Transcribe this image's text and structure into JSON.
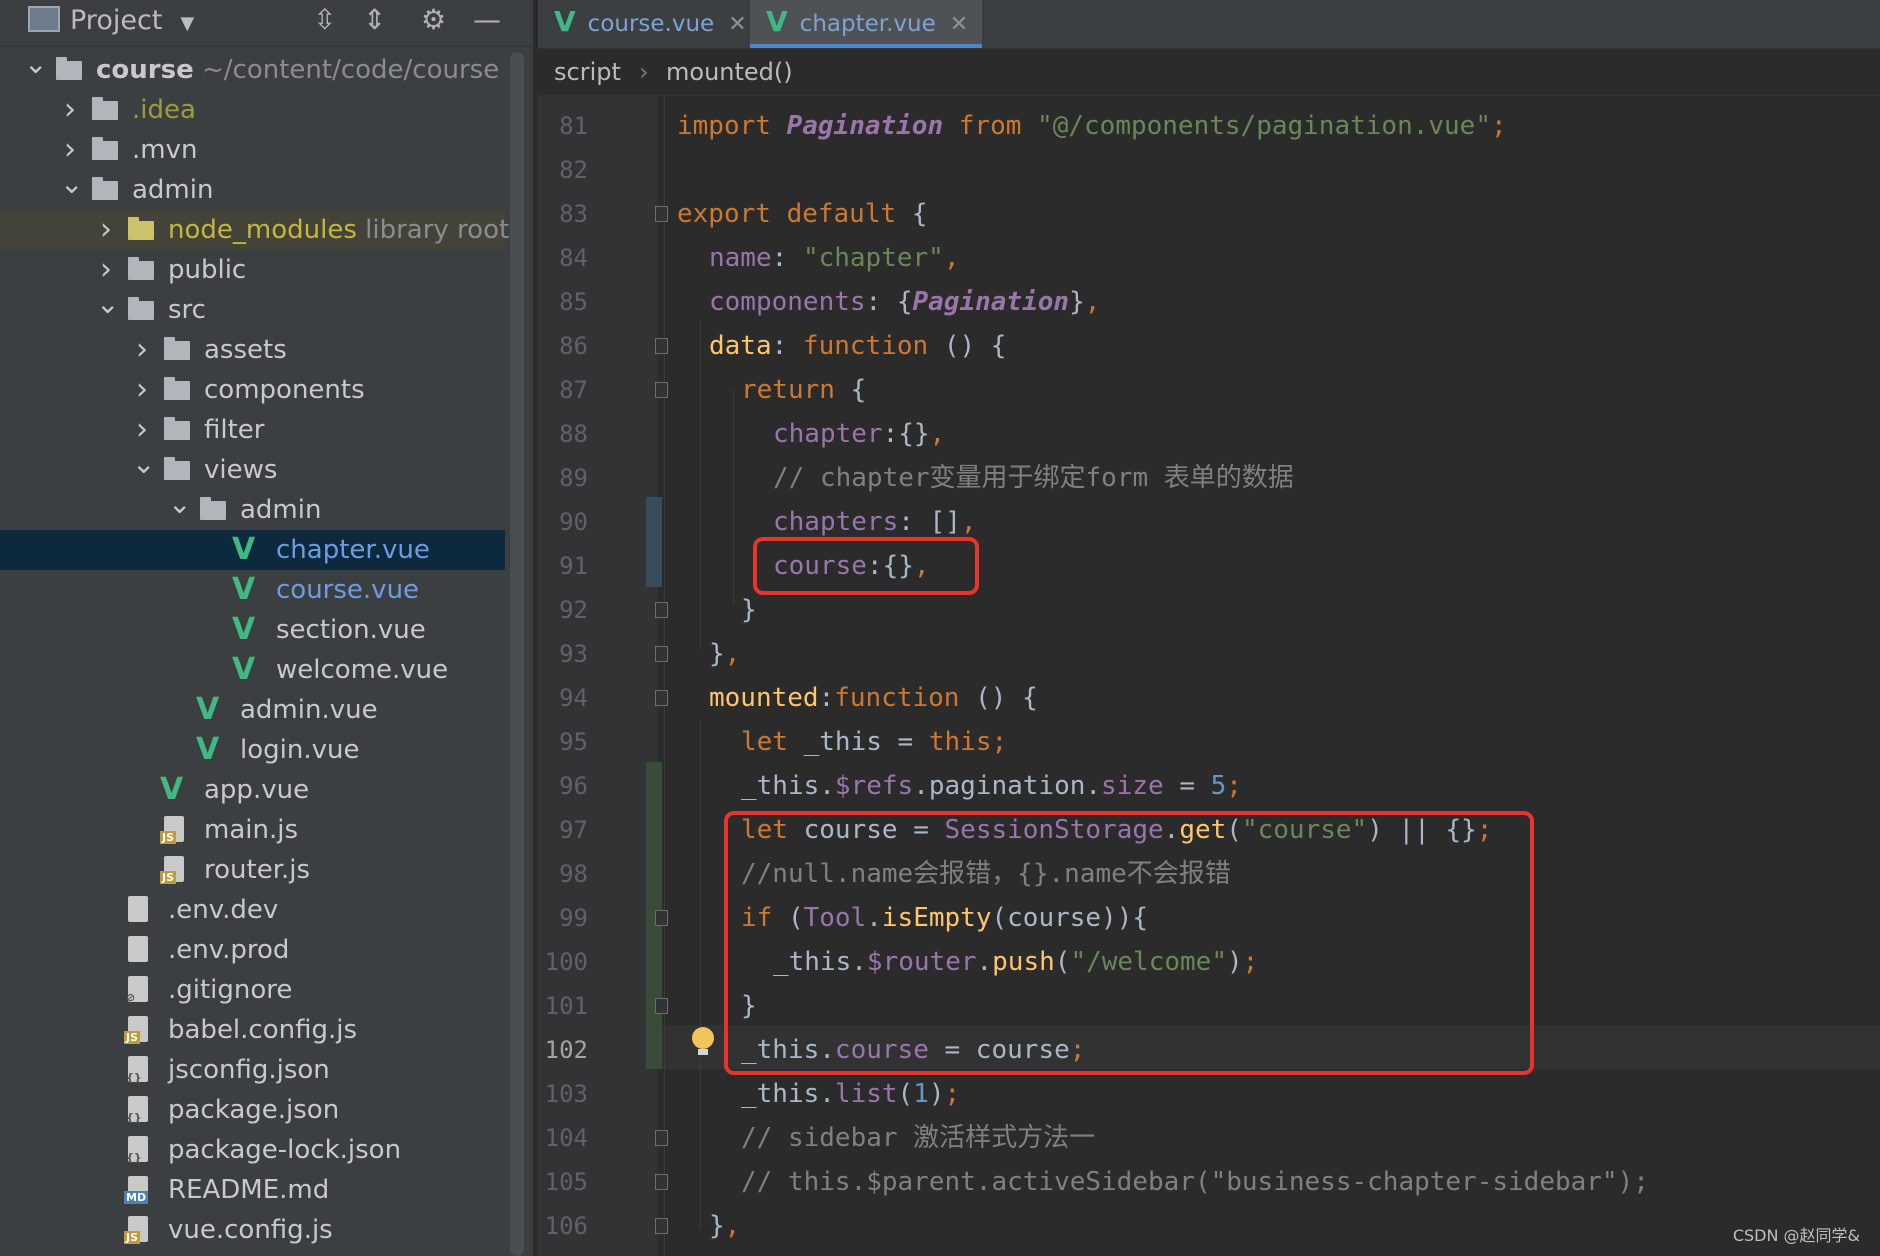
{
  "sidebar": {
    "title": "Project",
    "tree": [
      {
        "label": "course",
        "suffix": "~/content/code/course",
        "type": "root",
        "chevron": "down",
        "level": 0
      },
      {
        "label": ".idea",
        "type": "folder",
        "chevron": "right",
        "level": 1,
        "color": "#9c9c3a"
      },
      {
        "label": ".mvn",
        "type": "folder",
        "chevron": "right",
        "level": 1
      },
      {
        "label": "admin",
        "type": "folder",
        "chevron": "down",
        "level": 1
      },
      {
        "label": "node_modules",
        "suffix": "library root",
        "type": "folder-yellow",
        "chevron": "right",
        "level": 2,
        "color": "#c5b63c"
      },
      {
        "label": "public",
        "type": "folder",
        "chevron": "right",
        "level": 2
      },
      {
        "label": "src",
        "type": "folder",
        "chevron": "down",
        "level": 2
      },
      {
        "label": "assets",
        "type": "folder",
        "chevron": "right",
        "level": 3
      },
      {
        "label": "components",
        "type": "folder",
        "chevron": "right",
        "level": 3
      },
      {
        "label": "filter",
        "type": "folder",
        "chevron": "right",
        "level": 3
      },
      {
        "label": "views",
        "type": "folder",
        "chevron": "down",
        "level": 3
      },
      {
        "label": "admin",
        "type": "folder",
        "chevron": "down",
        "level": 4
      },
      {
        "label": "chapter.vue",
        "type": "vue",
        "level": 5,
        "color": "#6f9ce0",
        "selected": true
      },
      {
        "label": "course.vue",
        "type": "vue",
        "level": 5,
        "color": "#6f9ce0"
      },
      {
        "label": "section.vue",
        "type": "vue",
        "level": 5
      },
      {
        "label": "welcome.vue",
        "type": "vue",
        "level": 5
      },
      {
        "label": "admin.vue",
        "type": "vue",
        "level": 4
      },
      {
        "label": "login.vue",
        "type": "vue",
        "level": 4
      },
      {
        "label": "app.vue",
        "type": "vue",
        "level": 3
      },
      {
        "label": "main.js",
        "type": "js",
        "level": 3
      },
      {
        "label": "router.js",
        "type": "js",
        "level": 3
      },
      {
        "label": ".env.dev",
        "type": "text",
        "level": 2
      },
      {
        "label": ".env.prod",
        "type": "text",
        "level": 2
      },
      {
        "label": ".gitignore",
        "type": "ignore",
        "level": 2
      },
      {
        "label": "babel.config.js",
        "type": "js",
        "level": 2
      },
      {
        "label": "jsconfig.json",
        "type": "json",
        "level": 2
      },
      {
        "label": "package.json",
        "type": "json",
        "level": 2
      },
      {
        "label": "package-lock.json",
        "type": "json",
        "level": 2
      },
      {
        "label": "README.md",
        "type": "md",
        "level": 2
      },
      {
        "label": "vue.config.js",
        "type": "js",
        "level": 2
      }
    ]
  },
  "tabs": [
    {
      "label": "course.vue",
      "active": false
    },
    {
      "label": "chapter.vue",
      "active": true
    }
  ],
  "breadcrumb": {
    "first": "script",
    "sep": "›",
    "second": "mounted()"
  },
  "editor": {
    "current_line": 102,
    "lines": [
      {
        "n": 81,
        "indent": 0,
        "tokens": [
          [
            "kw",
            "import "
          ],
          [
            "cls",
            "Pagination"
          ],
          [
            "kw",
            " from "
          ],
          [
            "str",
            "\"@/components/pagination.vue\""
          ],
          [
            "kw",
            ";"
          ]
        ]
      },
      {
        "n": 82,
        "indent": 0,
        "tokens": []
      },
      {
        "n": 83,
        "indent": 0,
        "tokens": [
          [
            "kw",
            "export default "
          ],
          [
            "",
            "{"
          ]
        ]
      },
      {
        "n": 84,
        "indent": 1,
        "tokens": [
          [
            "prop",
            "name"
          ],
          [
            "",
            ": "
          ],
          [
            "str",
            "\"chapter\""
          ],
          [
            "kw",
            ","
          ]
        ]
      },
      {
        "n": 85,
        "indent": 1,
        "tokens": [
          [
            "prop",
            "components"
          ],
          [
            "",
            ": {"
          ],
          [
            "cls",
            "Pagination"
          ],
          [
            "",
            "}"
          ],
          [
            "kw",
            ","
          ]
        ]
      },
      {
        "n": 86,
        "indent": 1,
        "tokens": [
          [
            "fn",
            "data"
          ],
          [
            "",
            ": "
          ],
          [
            "kw",
            "function "
          ],
          [
            "",
            "() {"
          ]
        ]
      },
      {
        "n": 87,
        "indent": 2,
        "tokens": [
          [
            "kw",
            "return "
          ],
          [
            "",
            "{"
          ]
        ]
      },
      {
        "n": 88,
        "indent": 3,
        "tokens": [
          [
            "prop",
            "chapter"
          ],
          [
            "",
            ":{}"
          ],
          [
            "kw",
            ","
          ]
        ]
      },
      {
        "n": 89,
        "indent": 3,
        "tokens": [
          [
            "cmt",
            "// chapter变量用于绑定form 表单的数据"
          ]
        ]
      },
      {
        "n": 90,
        "indent": 3,
        "tokens": [
          [
            "prop",
            "chapters"
          ],
          [
            "",
            ": []"
          ],
          [
            "kw",
            ","
          ]
        ]
      },
      {
        "n": 91,
        "indent": 3,
        "tokens": [
          [
            "prop",
            "course"
          ],
          [
            "",
            ":{}"
          ],
          [
            "kw",
            ","
          ]
        ]
      },
      {
        "n": 92,
        "indent": 2,
        "tokens": [
          [
            "",
            "}"
          ]
        ]
      },
      {
        "n": 93,
        "indent": 1,
        "tokens": [
          [
            "",
            "}"
          ],
          [
            "kw",
            ","
          ]
        ]
      },
      {
        "n": 94,
        "indent": 1,
        "tokens": [
          [
            "fn",
            "mounted"
          ],
          [
            "",
            ":"
          ],
          [
            "kw",
            "function "
          ],
          [
            "",
            "() {"
          ]
        ]
      },
      {
        "n": 95,
        "indent": 2,
        "tokens": [
          [
            "kw",
            "let "
          ],
          [
            "",
            "_this = "
          ],
          [
            "kw",
            "this;"
          ]
        ]
      },
      {
        "n": 96,
        "indent": 2,
        "tokens": [
          [
            "",
            "_this."
          ],
          [
            "prop",
            "$refs"
          ],
          [
            "",
            ".pagination."
          ],
          [
            "prop",
            "size"
          ],
          [
            "",
            " = "
          ],
          [
            "num",
            "5"
          ],
          [
            "kw",
            ";"
          ]
        ]
      },
      {
        "n": 97,
        "indent": 2,
        "tokens": [
          [
            "kw",
            "let "
          ],
          [
            "",
            "course = "
          ],
          [
            "prop",
            "SessionStorage"
          ],
          [
            "",
            "."
          ],
          [
            "fn",
            "get"
          ],
          [
            "",
            "("
          ],
          [
            "str",
            "\"course\""
          ],
          [
            "",
            ") || {}"
          ],
          [
            "kw",
            ";"
          ]
        ]
      },
      {
        "n": 98,
        "indent": 2,
        "tokens": [
          [
            "cmt",
            "//null.name会报错，{}.name不会报错"
          ]
        ]
      },
      {
        "n": 99,
        "indent": 2,
        "tokens": [
          [
            "kw",
            "if "
          ],
          [
            "",
            "("
          ],
          [
            "prop",
            "Tool"
          ],
          [
            "",
            "."
          ],
          [
            "fn",
            "isEmpty"
          ],
          [
            "",
            "(course)){"
          ]
        ]
      },
      {
        "n": 100,
        "indent": 3,
        "tokens": [
          [
            "",
            "_this."
          ],
          [
            "prop",
            "$router"
          ],
          [
            "",
            "."
          ],
          [
            "fn",
            "push"
          ],
          [
            "",
            "("
          ],
          [
            "str",
            "\"/welcome\""
          ],
          [
            "",
            ")"
          ],
          [
            "kw",
            ";"
          ]
        ]
      },
      {
        "n": 101,
        "indent": 2,
        "tokens": [
          [
            "",
            "}"
          ]
        ]
      },
      {
        "n": 102,
        "indent": 2,
        "tokens": [
          [
            "",
            "_this."
          ],
          [
            "prop",
            "course"
          ],
          [
            "",
            " = course"
          ],
          [
            "kw",
            ";"
          ]
        ]
      },
      {
        "n": 103,
        "indent": 2,
        "tokens": [
          [
            "",
            "_this."
          ],
          [
            "prop",
            "list"
          ],
          [
            "",
            "("
          ],
          [
            "num",
            "1"
          ],
          [
            "",
            ")"
          ],
          [
            "kw",
            ";"
          ]
        ]
      },
      {
        "n": 104,
        "indent": 2,
        "tokens": [
          [
            "cmt",
            "// sidebar 激活样式方法一"
          ]
        ]
      },
      {
        "n": 105,
        "indent": 2,
        "tokens": [
          [
            "cmt",
            "// this.$parent.activeSidebar(\"business-chapter-sidebar\");"
          ]
        ]
      },
      {
        "n": 106,
        "indent": 1,
        "tokens": [
          [
            "",
            "}"
          ],
          [
            "kw",
            ","
          ]
        ]
      }
    ]
  },
  "watermark": "CSDN @赵同学&",
  "colors": {
    "highlight_box": "#e8352b",
    "accent": "#4a88c7",
    "vue_green": "#41b883"
  }
}
